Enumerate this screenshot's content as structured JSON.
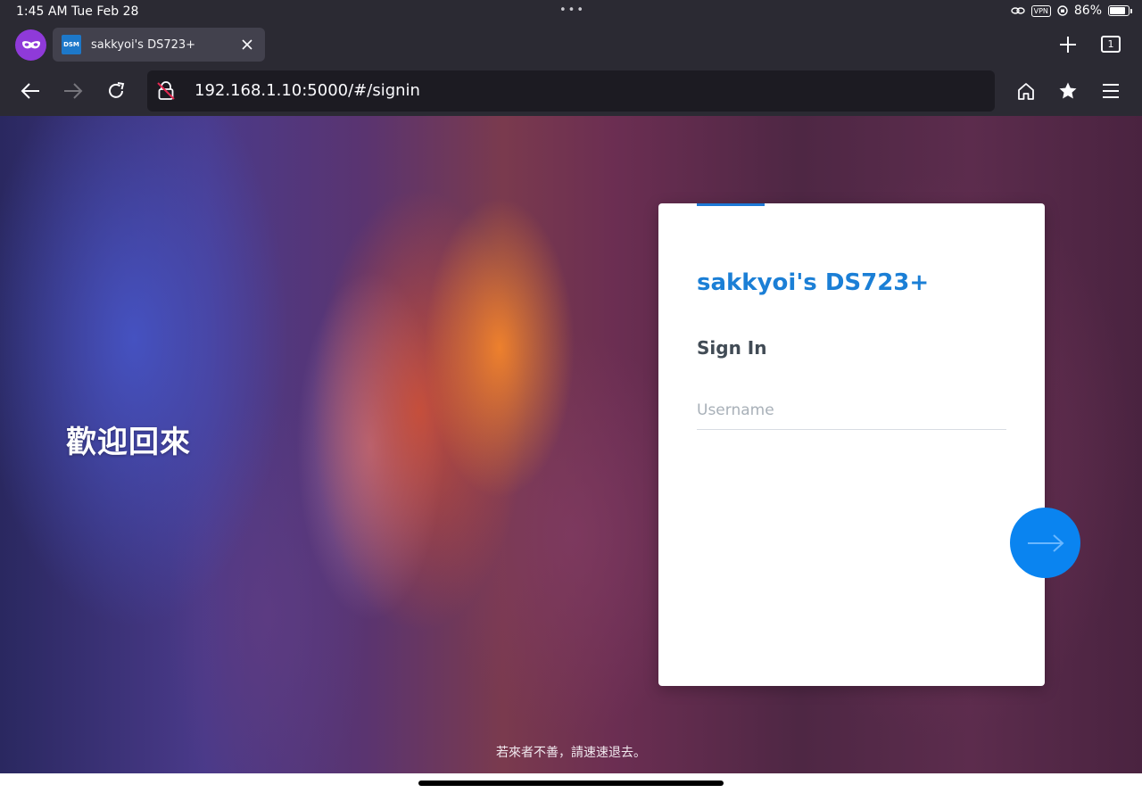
{
  "status_bar": {
    "time": "1:45 AM",
    "date": "Tue Feb 28",
    "vpn": "VPN",
    "battery_percent": "86%",
    "battery_level": 0.86
  },
  "tabs": {
    "active_tab": {
      "favicon_text": "DSM",
      "title": "sakkyoi's DS723+"
    },
    "tab_count": "1"
  },
  "nav": {
    "url": "192.168.1.10:5000/#/signin"
  },
  "page": {
    "welcome_text": "歡迎回來",
    "login": {
      "host_name": "sakkyoi's DS723+",
      "title": "Sign In",
      "username_placeholder": "Username",
      "username_value": ""
    },
    "footer_message": "若來者不善，請速速退去。"
  },
  "colors": {
    "accent": "#1b7fd6",
    "next_button": "#0a84f0",
    "browser_chrome": "#2b2a33",
    "private_badge": "#8f3ad9"
  },
  "icons": {
    "private": "private-mask-icon",
    "back": "arrow-left-icon",
    "forward": "arrow-right-icon",
    "reload": "reload-icon",
    "insecure": "insecure-lock-icon",
    "home": "home-icon",
    "bookmarks": "star-icon",
    "menu": "hamburger-menu-icon",
    "next": "arrow-right-icon"
  }
}
